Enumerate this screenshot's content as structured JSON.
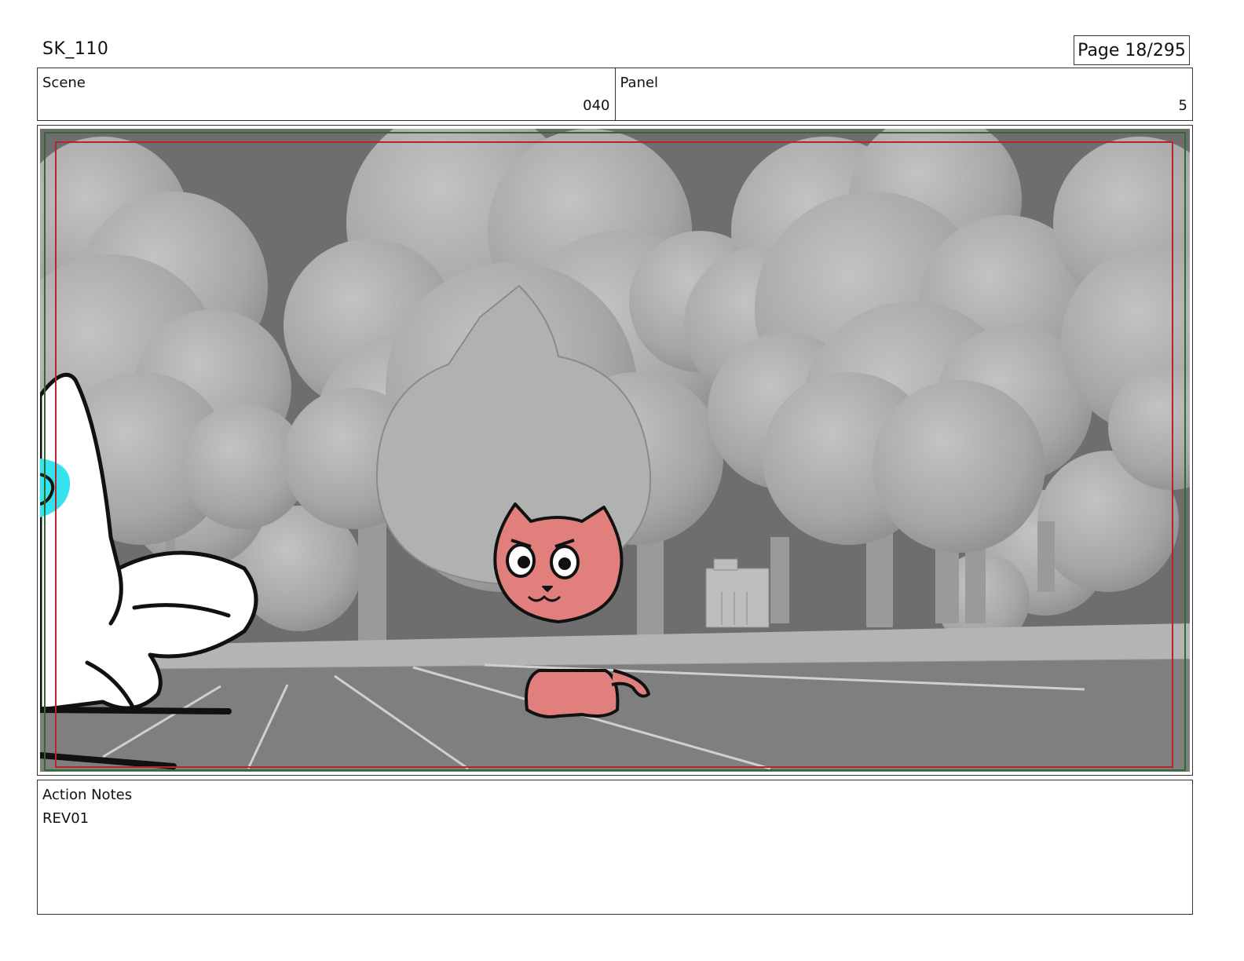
{
  "header": {
    "project_code": "SK_110",
    "page_label": "Page 18/295"
  },
  "info": {
    "scene_label": "Scene",
    "scene_value": "040",
    "panel_label": "Panel",
    "panel_value": "5"
  },
  "panel": {
    "colors": {
      "sky": "#6f6f6f",
      "foliage": "#a9a9a9",
      "ground": "#7e7e7e",
      "safe_area_red": "#b3262c",
      "safe_area_green": "#2e6b32",
      "cat_body": "#e07f7c",
      "character_accent": "#35e3ee"
    }
  },
  "notes": {
    "label": "Action Notes",
    "text": "REV01"
  }
}
